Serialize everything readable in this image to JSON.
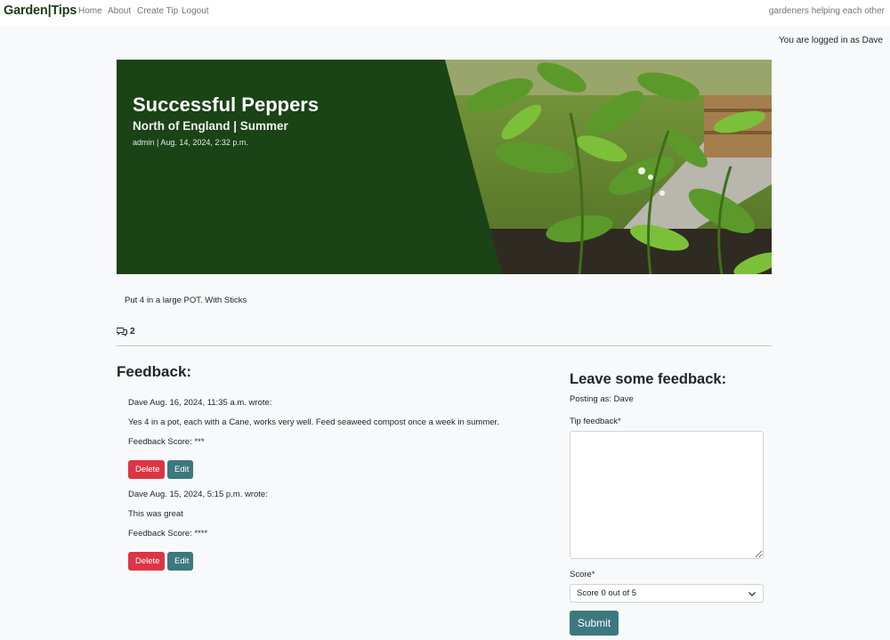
{
  "navbar": {
    "brand": "Garden|Tips",
    "links": [
      "Home",
      "About",
      "Create Tip",
      "Logout"
    ],
    "tagline": "gardeners helping each other"
  },
  "status": {
    "logged_in": "You are logged in as Dave"
  },
  "tip": {
    "title": "Successful Peppers",
    "subtitle": "North of England | Summer",
    "meta": "admin | Aug. 14, 2024, 2:32 p.m.",
    "content": "Put 4 in a large POT. With Sticks",
    "comment_count": "2",
    "comment_icon": "comments-icon"
  },
  "feedback": {
    "heading": "Feedback:",
    "items": [
      {
        "author_line": "Dave Aug. 16, 2024, 11:35 a.m. wrote:",
        "body": "Yes 4 in a pot, each with a Cane, works very well. Feed seaweed compost once a week in summer.",
        "score": "Feedback Score: ***",
        "delete_label": "Delete",
        "edit_label": "Edit"
      },
      {
        "author_line": "Dave Aug. 15, 2024, 5:15 p.m. wrote:",
        "body": "This was great",
        "score": "Feedback Score: ****",
        "delete_label": "Delete",
        "edit_label": "Edit"
      }
    ]
  },
  "form": {
    "heading": "Leave some feedback:",
    "posting_as": "Posting as: Dave",
    "feedback_label": "Tip feedback*",
    "feedback_value": "",
    "score_label": "Score*",
    "score_selected": "Score 0 out of 5",
    "submit_label": "Submit"
  },
  "colors": {
    "brand": "#1d3b16",
    "hero_green": "#1a4316",
    "danger": "#dc3545",
    "teal": "#3c787d"
  }
}
